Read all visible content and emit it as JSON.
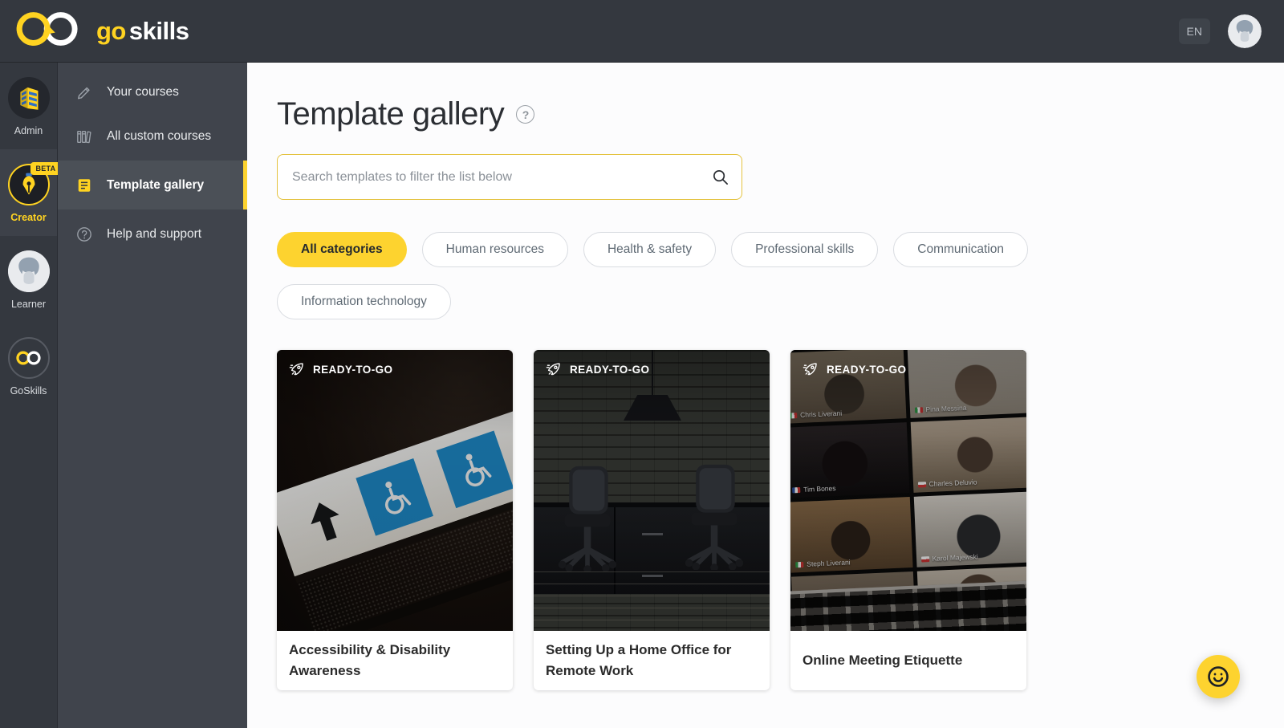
{
  "colors": {
    "accent_yellow": "#fdd32f",
    "logo_yellow": "#ffd321",
    "topbar_bg": "#34383f",
    "sidebar_bg": "#40444c",
    "selected_row_bg": "#4b5057",
    "main_bg": "#fcfcfd",
    "search_border": "#e4c23e",
    "pill_border": "#d9dce1",
    "pill_text": "#5f6a74",
    "title_text": "#2b2e33",
    "card_title_text": "#2b2b2b",
    "sign_blue": "#1f8fd0"
  },
  "brand": {
    "go": "go",
    "skills": "skills"
  },
  "topbar": {
    "language": "EN"
  },
  "rail": {
    "items": [
      {
        "label": "Admin"
      },
      {
        "label": "Creator",
        "badge": "BETA"
      },
      {
        "label": "Learner"
      },
      {
        "label": "GoSkills"
      }
    ]
  },
  "sidebar": {
    "items": [
      {
        "label": "Your courses"
      },
      {
        "label": "All custom courses"
      },
      {
        "label": "Template gallery"
      },
      {
        "label": "Help and support"
      }
    ]
  },
  "main": {
    "title": "Template gallery",
    "search": {
      "placeholder": "Search templates to filter the list below"
    },
    "categories": [
      {
        "label": "All categories",
        "selected": true
      },
      {
        "label": "Human resources",
        "selected": false
      },
      {
        "label": "Health & safety",
        "selected": false
      },
      {
        "label": "Professional skills",
        "selected": false
      },
      {
        "label": "Communication",
        "selected": false
      },
      {
        "label": "Information technology",
        "selected": false
      }
    ],
    "cards": [
      {
        "badge": "READY-TO-GO",
        "title": "Accessibility & Disability Awareness",
        "image_desc": "accessibility-wheelchair-sign-photo"
      },
      {
        "badge": "READY-TO-GO",
        "title": "Setting Up a Home Office for Remote Work",
        "image_desc": "home-office-desk-chairs-photo"
      },
      {
        "badge": "READY-TO-GO",
        "title": "Online Meeting Etiquette",
        "image_desc": "laptop-video-call-grid-photo",
        "participants": [
          {
            "name": "Chris Liverani",
            "flag": "it"
          },
          {
            "name": "Pina Messina",
            "flag": "it"
          },
          {
            "name": "Tim Bones",
            "flag": "fr"
          },
          {
            "name": "Charles Deluvio",
            "flag": "cl"
          },
          {
            "name": "Steph Liverani",
            "flag": "it"
          },
          {
            "name": "Karol Majewski",
            "flag": "pl"
          }
        ]
      }
    ]
  },
  "icons": {
    "help_glyph": "?"
  }
}
